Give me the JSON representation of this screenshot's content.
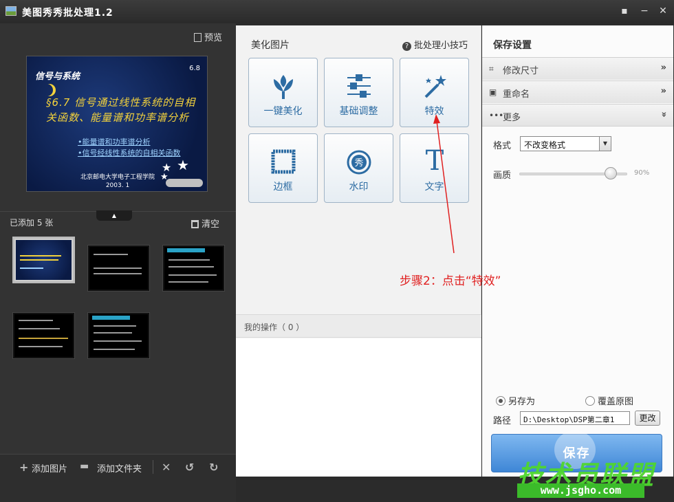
{
  "window": {
    "title": "美图秀秀批处理1.2",
    "icons": [
      "app-icon",
      "feedback-icon",
      "minimize-icon",
      "close-icon"
    ]
  },
  "left_panel": {
    "preview_label": "预览",
    "slide": {
      "series_title": "信号与系统",
      "page": "6.8",
      "heading": "§6.7 信号通过线性系统的自相关函数、能量谱和功率谱分析",
      "bullets": [
        "•能量谱和功率谱分析",
        "•信号经线性系统的自相关函数"
      ],
      "footer_line1": "北京邮电大学电子工程学院",
      "footer_line2": "2003. 1"
    },
    "added_label": "已添加 5 张",
    "clear_label": "清空",
    "thumbnail_count": 5,
    "selected_thumbnail": 1,
    "add_image_label": "添加图片",
    "add_folder_label": "添加文件夹"
  },
  "middle_panel": {
    "title": "美化图片",
    "tips_label": "批处理小技巧",
    "tools": [
      {
        "label": "一键美化",
        "icon": "tulip-icon"
      },
      {
        "label": "基础调整",
        "icon": "sliders-icon"
      },
      {
        "label": "特效",
        "icon": "magic-wand-icon"
      },
      {
        "label": "边框",
        "icon": "frame-icon"
      },
      {
        "label": "水印",
        "icon": "watermark-icon"
      },
      {
        "label": "文字",
        "icon": "text-icon"
      }
    ],
    "ops_label": "我的操作（ 0 ）"
  },
  "right_panel": {
    "title": "保存设置",
    "accordion": [
      {
        "label": "修改尺寸",
        "icon": "crop-icon"
      },
      {
        "label": "重命名",
        "icon": "rename-icon"
      },
      {
        "label": "更多",
        "icon": "more-icon"
      }
    ],
    "format_label": "格式",
    "format_value": "不改变格式",
    "quality_label": "画质",
    "quality_value": "90%",
    "quality_level": 0.9,
    "save_as_label": "另存为",
    "overwrite_label": "覆盖原图",
    "path_label": "路径",
    "path_value": "D:\\Desktop\\DSP第二章1",
    "change_label": "更改",
    "save_label": "保存"
  },
  "annotation": {
    "text": "步骤2：点击“特效”",
    "color": "#e02020"
  },
  "watermark": {
    "text": "技术员联盟",
    "url": "www.jsgho.com"
  }
}
